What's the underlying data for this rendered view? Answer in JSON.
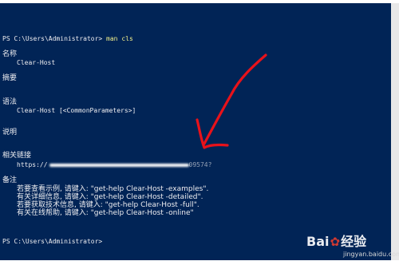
{
  "console": {
    "prompt_line": "PS C:\\Users\\Administrator> ",
    "command": "man cls",
    "name_heading": "名称",
    "name_value": "Clear-Host",
    "synopsis_heading": "摘要",
    "syntax_heading": "语法",
    "syntax_value": "Clear-Host [<CommonParameters>]",
    "description_heading": "说明",
    "related_links_heading": "相关链接",
    "related_link_prefix": "https://",
    "related_link_tail": "09574?",
    "remarks_heading": "备注",
    "remarks": [
      "若要查看示例, 请键入: \"get-help Clear-Host -examples\".",
      "有关详细信息, 请键入: \"get-help Clear-Host -detailed\".",
      "若要获取技术信息, 请键入: \"get-help Clear-Host -full\".",
      "有关在线帮助, 请键入: \"get-help Clear-Host -online\""
    ],
    "final_prompt": "PS C:\\Users\\Administrator>"
  },
  "annotation": {
    "arrow_color": "#e8121a"
  },
  "watermark": {
    "logo_left": "Bai",
    "logo_paw": "✿",
    "logo_right": "经验",
    "url": "jingyan.baidu.com"
  }
}
